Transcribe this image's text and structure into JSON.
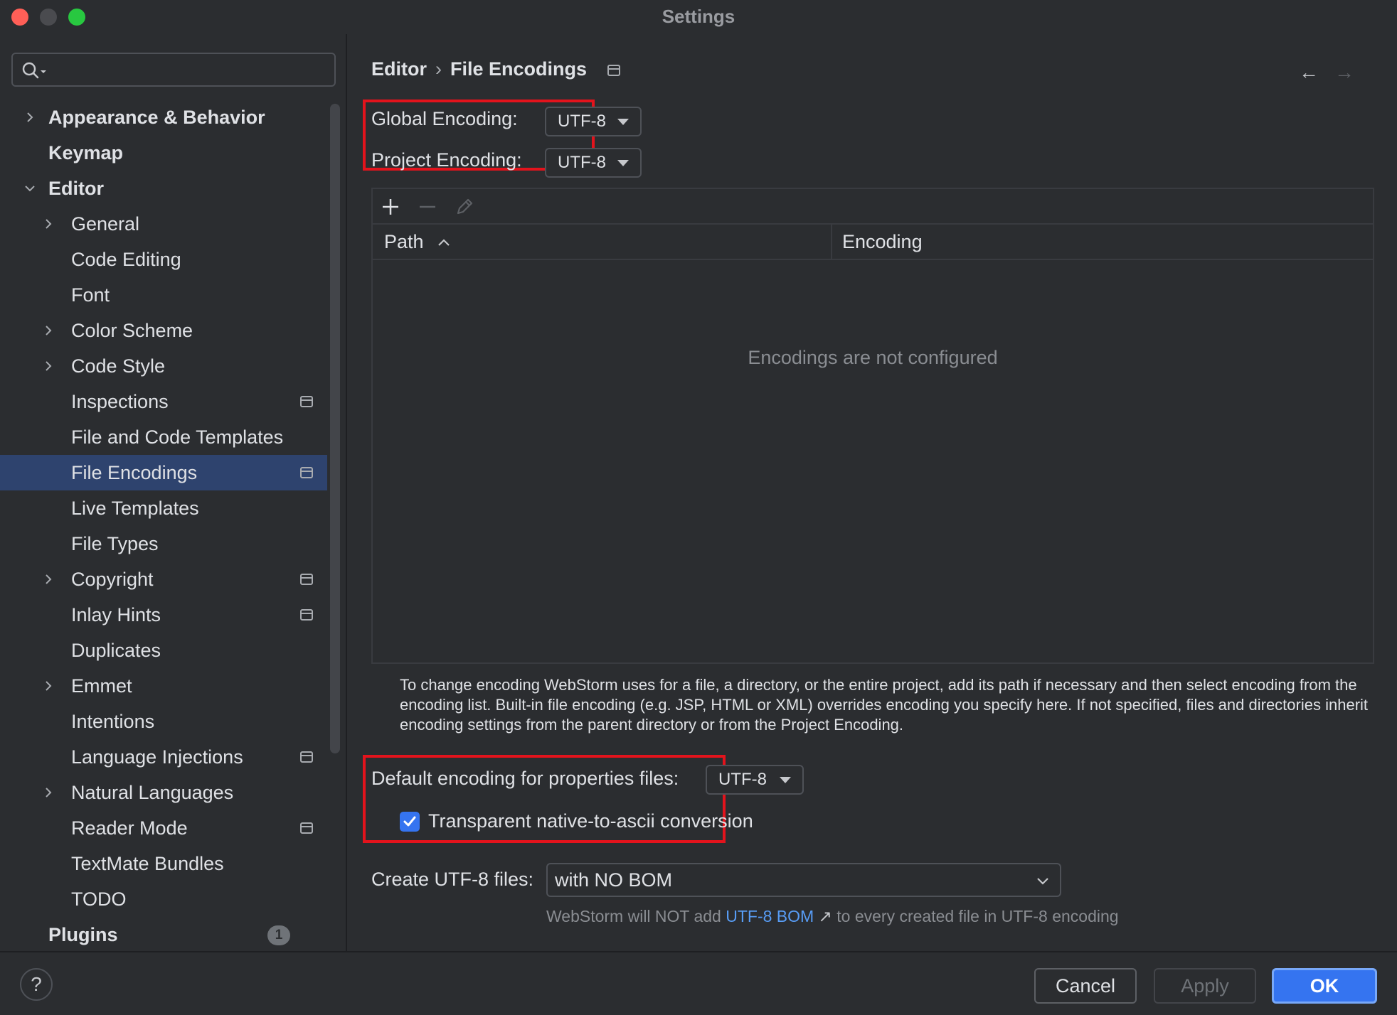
{
  "window": {
    "title": "Settings"
  },
  "sidebar": {
    "search_placeholder": "",
    "items": [
      {
        "label": "Appearance & Behavior",
        "level": 0,
        "bold": true,
        "expandable": true,
        "expanded": false
      },
      {
        "label": "Keymap",
        "level": 0,
        "bold": true
      },
      {
        "label": "Editor",
        "level": 0,
        "bold": true,
        "expandable": true,
        "expanded": true
      },
      {
        "label": "General",
        "level": 1,
        "expandable": true
      },
      {
        "label": "Code Editing",
        "level": 1
      },
      {
        "label": "Font",
        "level": 1
      },
      {
        "label": "Color Scheme",
        "level": 1,
        "expandable": true
      },
      {
        "label": "Code Style",
        "level": 1,
        "expandable": true
      },
      {
        "label": "Inspections",
        "level": 1,
        "project_icon": true
      },
      {
        "label": "File and Code Templates",
        "level": 1
      },
      {
        "label": "File Encodings",
        "level": 1,
        "project_icon": true,
        "selected": true
      },
      {
        "label": "Live Templates",
        "level": 1
      },
      {
        "label": "File Types",
        "level": 1
      },
      {
        "label": "Copyright",
        "level": 1,
        "expandable": true,
        "project_icon": true
      },
      {
        "label": "Inlay Hints",
        "level": 1,
        "project_icon": true
      },
      {
        "label": "Duplicates",
        "level": 1
      },
      {
        "label": "Emmet",
        "level": 1,
        "expandable": true
      },
      {
        "label": "Intentions",
        "level": 1
      },
      {
        "label": "Language Injections",
        "level": 1,
        "project_icon": true
      },
      {
        "label": "Natural Languages",
        "level": 1,
        "expandable": true
      },
      {
        "label": "Reader Mode",
        "level": 1,
        "project_icon": true
      },
      {
        "label": "TextMate Bundles",
        "level": 1
      },
      {
        "label": "TODO",
        "level": 1
      },
      {
        "label": "Plugins",
        "level": 0,
        "bold": true,
        "badge": "1"
      }
    ]
  },
  "breadcrumb": {
    "parent": "Editor",
    "separator": "›",
    "current": "File Encodings"
  },
  "nav": {
    "back": "←",
    "forward": "→"
  },
  "encodings": {
    "global_label": "Global Encoding:",
    "global_value": "UTF-8",
    "project_label": "Project Encoding:",
    "project_value": "UTF-8"
  },
  "table": {
    "toolbar": {
      "add": "add-icon",
      "remove": "remove-icon",
      "edit": "edit-icon"
    },
    "columns": [
      "Path",
      "Encoding"
    ],
    "sort_indicator": "^",
    "empty_text": "Encodings are not configured",
    "rows": []
  },
  "help_text": "To change encoding WebStorm uses for a file, a directory, or the entire project, add its path if necessary and then select encoding from the encoding list. Built-in file encoding (e.g. JSP, HTML or XML) overrides encoding you specify here. If not specified, files and directories inherit encoding settings from the parent directory or from the Project Encoding.",
  "properties": {
    "label": "Default encoding for properties files:",
    "value": "UTF-8",
    "native_to_ascii_label": "Transparent native-to-ascii conversion",
    "native_to_ascii_checked": true
  },
  "utf8": {
    "label": "Create UTF-8 files:",
    "value": "with NO BOM",
    "hint_before": "WebStorm will NOT add ",
    "hint_link": "UTF-8 BOM",
    "hint_arrow": "↗",
    "hint_after": " to every created file in UTF-8 encoding"
  },
  "footer": {
    "help": "?",
    "cancel": "Cancel",
    "apply": "Apply",
    "ok": "OK"
  },
  "colors": {
    "background": "#2b2d30",
    "selection": "#2e436e",
    "accent": "#3574f0",
    "highlight_box": "#e3131c",
    "link": "#589df6"
  }
}
